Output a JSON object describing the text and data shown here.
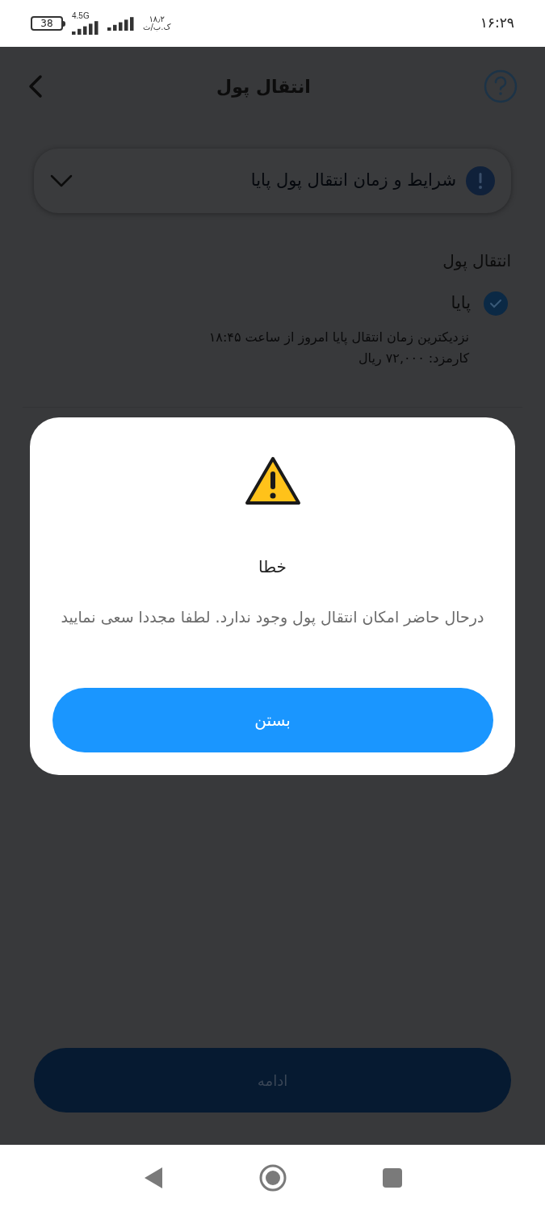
{
  "status_bar": {
    "battery": "38",
    "network": "4.5G",
    "speed_value": "۱۸٫۲",
    "speed_unit": "ک.ب/ث",
    "time": "۱۶:۲۹"
  },
  "header": {
    "title": "انتقال پول"
  },
  "info_panel": {
    "title": "شرایط و زمان انتقال پول پایا",
    "expanded": false
  },
  "section": {
    "title": "انتقال پول",
    "options": [
      {
        "label": "پایا",
        "selected": true,
        "details": [
          "نزدیکترین زمان انتقال پایا امروز از ساعت ۱۸:۴۵",
          "کارمزد: ۷۲,۰۰۰ ریال"
        ]
      }
    ]
  },
  "continue_button": {
    "label": "ادامه",
    "disabled": true
  },
  "dialog": {
    "title": "خطا",
    "message": "درحال حاضر امکان انتقال پول وجود ندارد. لطفا مجددا سعی نمایید",
    "button": "بستن"
  }
}
